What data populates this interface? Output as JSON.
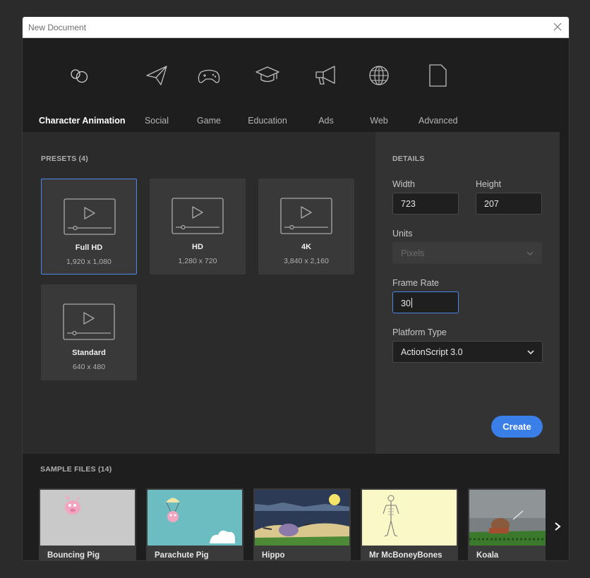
{
  "window": {
    "title": "New Document"
  },
  "tabs": [
    {
      "label": "Character Animation",
      "icon": "character-animation-icon"
    },
    {
      "label": "Social",
      "icon": "paper-plane-icon"
    },
    {
      "label": "Game",
      "icon": "gamepad-icon"
    },
    {
      "label": "Education",
      "icon": "graduation-cap-icon"
    },
    {
      "label": "Ads",
      "icon": "megaphone-icon"
    },
    {
      "label": "Web",
      "icon": "globe-icon"
    },
    {
      "label": "Advanced",
      "icon": "document-icon"
    }
  ],
  "presets": {
    "title": "PRESETS (4)",
    "items": [
      {
        "name": "Full HD",
        "dims": "1,920 x 1,080"
      },
      {
        "name": "HD",
        "dims": "1,280 x 720"
      },
      {
        "name": "4K",
        "dims": "3,840 x 2,160"
      },
      {
        "name": "Standard",
        "dims": "640 x 480"
      }
    ]
  },
  "details": {
    "title": "DETAILS",
    "width_label": "Width",
    "width_value": "723",
    "height_label": "Height",
    "height_value": "207",
    "units_label": "Units",
    "units_value": "Pixels",
    "frame_rate_label": "Frame Rate",
    "frame_rate_value": "30",
    "platform_label": "Platform Type",
    "platform_value": "ActionScript 3.0",
    "create_label": "Create"
  },
  "samples": {
    "title": "SAMPLE FILES (14)",
    "items": [
      {
        "name": "Bouncing Pig"
      },
      {
        "name": "Parachute Pig"
      },
      {
        "name": "Hippo"
      },
      {
        "name": "Mr McBoneyBones"
      },
      {
        "name": "Koala"
      }
    ]
  },
  "colors": {
    "accent": "#4b87e8",
    "button": "#3a7ee8",
    "panel": "#2b2b2b",
    "details_panel": "#333333"
  }
}
